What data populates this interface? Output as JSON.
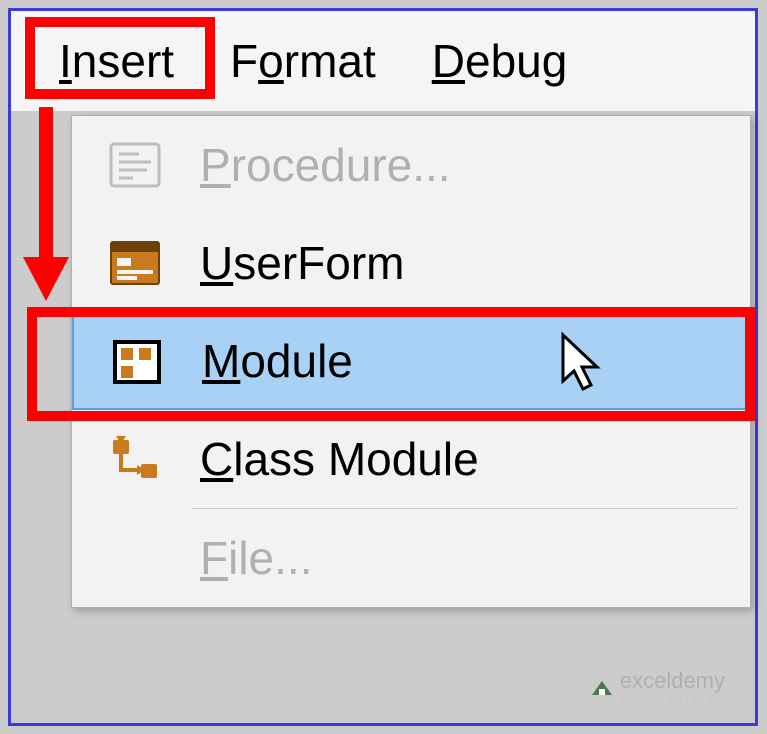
{
  "menubar": {
    "insert": {
      "pre": "I",
      "rest": "nsert"
    },
    "format": {
      "pre": "F",
      "mid": "o",
      "rest": "rmat"
    },
    "debug": {
      "pre": "D",
      "rest": "ebug"
    }
  },
  "dropdown": {
    "procedure": {
      "pre": "P",
      "rest": "rocedure..."
    },
    "userform": {
      "pre": "U",
      "rest": "serForm"
    },
    "module": {
      "pre": "M",
      "rest": "odule"
    },
    "classmodule": {
      "pre": "C",
      "rest": "lass Module"
    },
    "file": {
      "pre": "F",
      "rest": "ile..."
    }
  },
  "icons": {
    "procedure": "procedure-icon",
    "userform": "userform-icon",
    "module": "module-icon",
    "classmodule": "classmodule-icon"
  },
  "highlight_color": "#ff0000",
  "selection_bg": "#a8d1f5",
  "watermark": {
    "brand": "exceldemy",
    "tagline": "EXCEL · DATA · BI"
  }
}
